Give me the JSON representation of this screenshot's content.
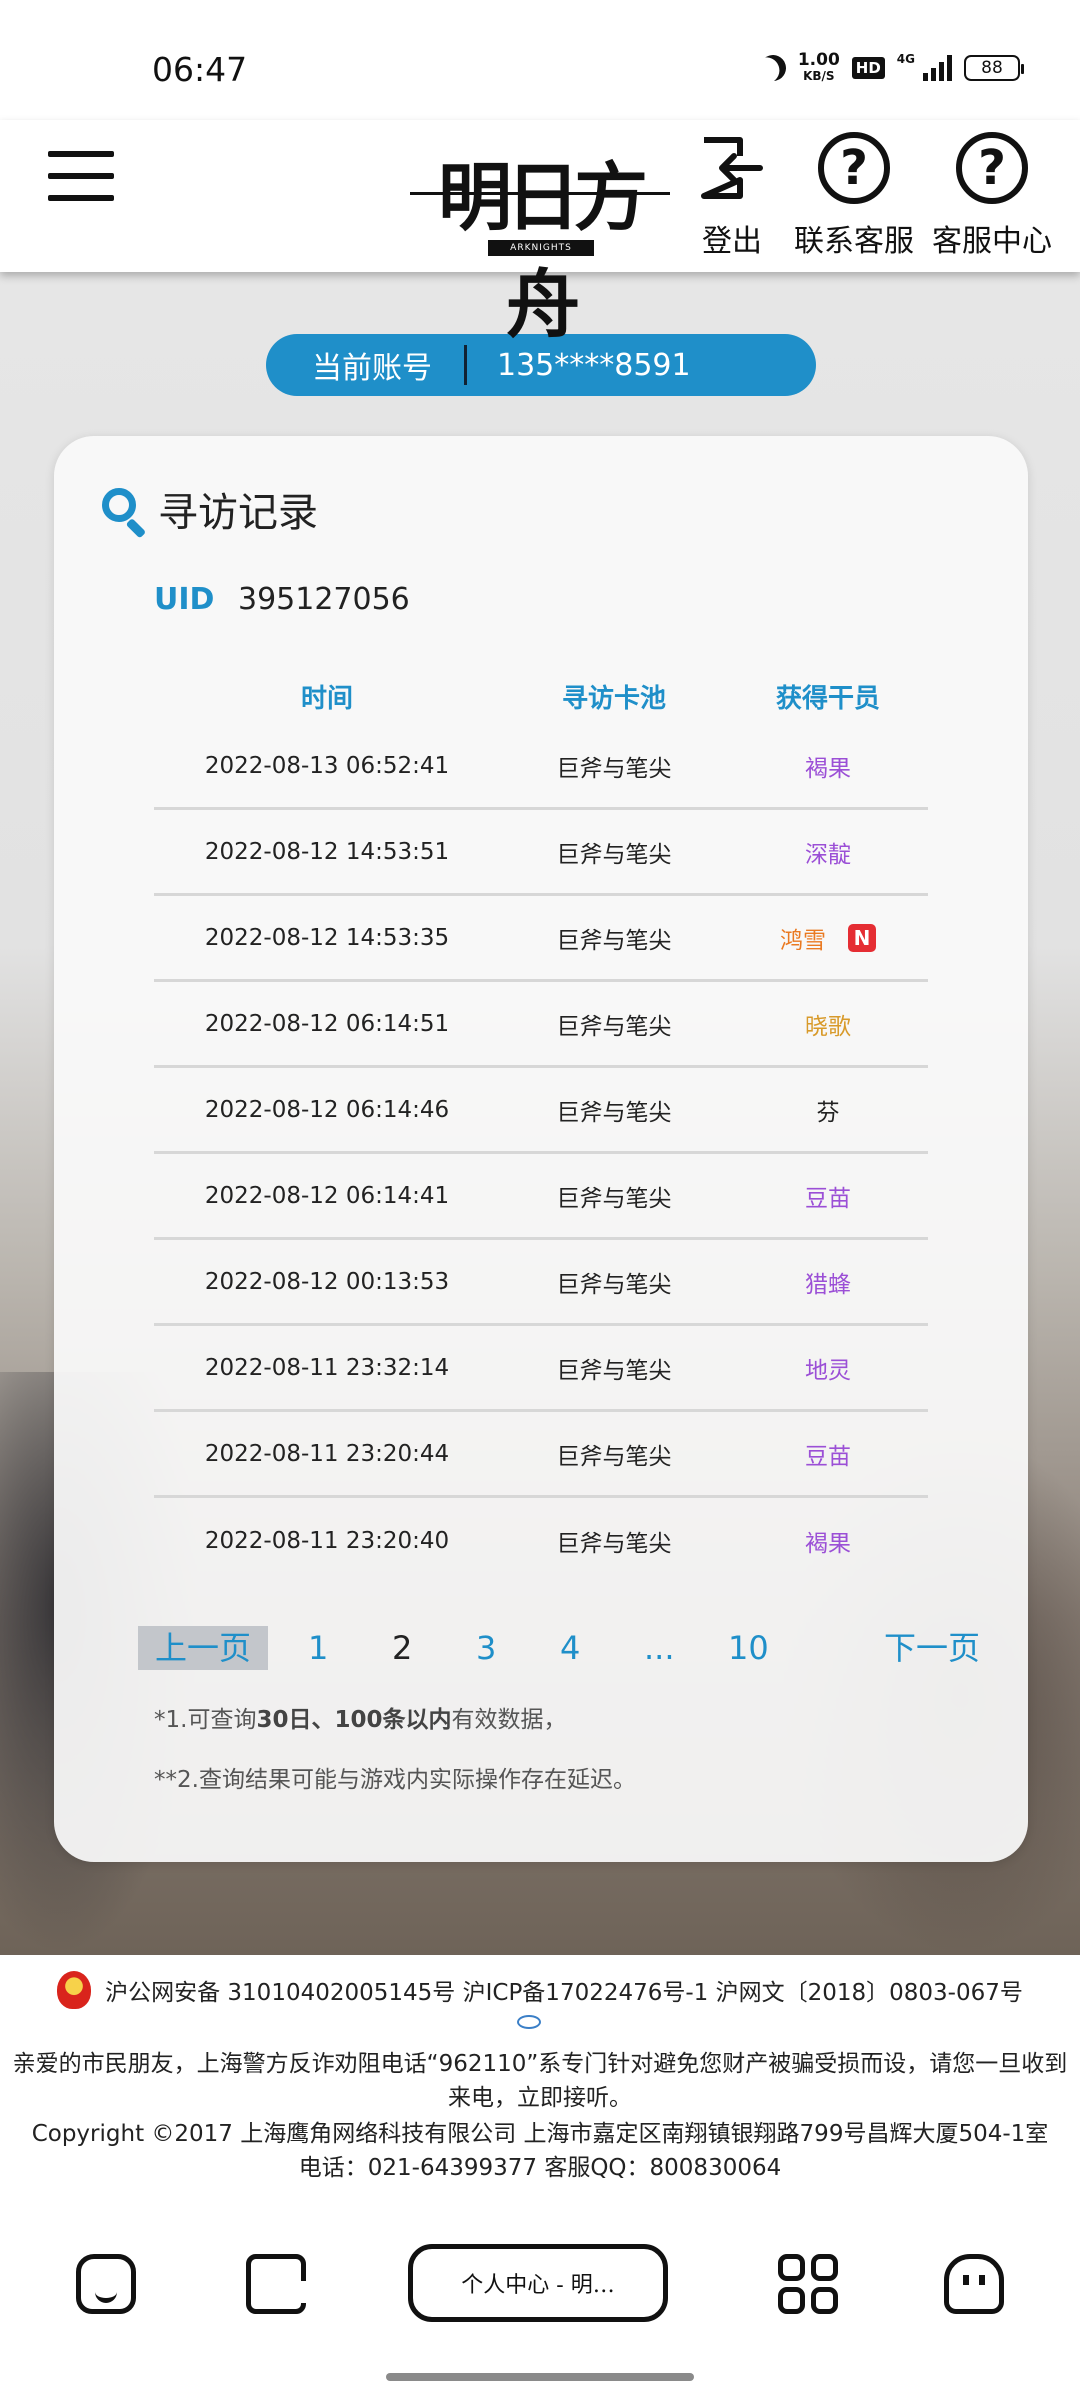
{
  "status": {
    "time": "06:47",
    "net_speed_value": "1.00",
    "net_speed_unit": "KB/S",
    "hd": "HD",
    "network": "4G",
    "battery": "88"
  },
  "header": {
    "logo_text": "明日方舟",
    "logo_sub": "ARKNIGHTS",
    "logout_label": "登出",
    "contact_label": "联系客服",
    "service_center_label": "客服中心"
  },
  "account": {
    "label": "当前账号",
    "value": "135****8591"
  },
  "card": {
    "title": "寻访记录",
    "uid_label": "UID",
    "uid_value": "395127056"
  },
  "table": {
    "headers": [
      "时间",
      "寻访卡池",
      "获得干员"
    ],
    "rows": [
      {
        "time": "2022-08-13 06:52:41",
        "pool": "巨斧与笔尖",
        "operator": "褐果",
        "color": "#9b4fd6",
        "is_new": false
      },
      {
        "time": "2022-08-12 14:53:51",
        "pool": "巨斧与笔尖",
        "operator": "深靛",
        "color": "#9b4fd6",
        "is_new": false
      },
      {
        "time": "2022-08-12 14:53:35",
        "pool": "巨斧与笔尖",
        "operator": "鸿雪",
        "color": "#ea7a22",
        "is_new": true,
        "new_label": "N"
      },
      {
        "time": "2022-08-12 06:14:51",
        "pool": "巨斧与笔尖",
        "operator": "晓歌",
        "color": "#d89a2a",
        "is_new": false
      },
      {
        "time": "2022-08-12 06:14:46",
        "pool": "巨斧与笔尖",
        "operator": "芬",
        "color": "#222222",
        "is_new": false
      },
      {
        "time": "2022-08-12 06:14:41",
        "pool": "巨斧与笔尖",
        "operator": "豆苗",
        "color": "#9b4fd6",
        "is_new": false
      },
      {
        "time": "2022-08-12 00:13:53",
        "pool": "巨斧与笔尖",
        "operator": "猎蜂",
        "color": "#9b4fd6",
        "is_new": false
      },
      {
        "time": "2022-08-11 23:32:14",
        "pool": "巨斧与笔尖",
        "operator": "地灵",
        "color": "#9b4fd6",
        "is_new": false
      },
      {
        "time": "2022-08-11 23:20:44",
        "pool": "巨斧与笔尖",
        "operator": "豆苗",
        "color": "#9b4fd6",
        "is_new": false
      },
      {
        "time": "2022-08-11 23:20:40",
        "pool": "巨斧与笔尖",
        "operator": "褐果",
        "color": "#9b4fd6",
        "is_new": false
      }
    ]
  },
  "pagination": {
    "prev": "上一页",
    "pages": [
      "1",
      "2",
      "3",
      "4",
      "...",
      "10"
    ],
    "current": "2",
    "next": "下一页"
  },
  "notes": {
    "n1_prefix": "*1.可查询",
    "n1_bold": "30日、100条以内",
    "n1_suffix": "有效数据，",
    "n2": "**2.查询结果可能与游戏内实际操作存在延迟。"
  },
  "footer": {
    "line1": "沪公网安备 31010402005145号  沪ICP备17022476号-1  沪网文〔2018〕0803-067号",
    "line2": "亲爱的市民朋友，上海警方反诈劝阻电话“962110”系专门针对避免您财产被骗受损而设，请您一旦收到来电，立即接听。",
    "line3": "Copyright ©2017 上海鹰角网络科技有限公司 上海市嘉定区南翔镇银翔路799号昌辉大厦504-1室",
    "line4": "电话：021-64399377 客服QQ：800830064"
  },
  "navbar": {
    "tab_title": "个人中心 - 明…"
  },
  "colors": {
    "accent": "#1f8fc9",
    "new_badge": "#e52d33"
  }
}
